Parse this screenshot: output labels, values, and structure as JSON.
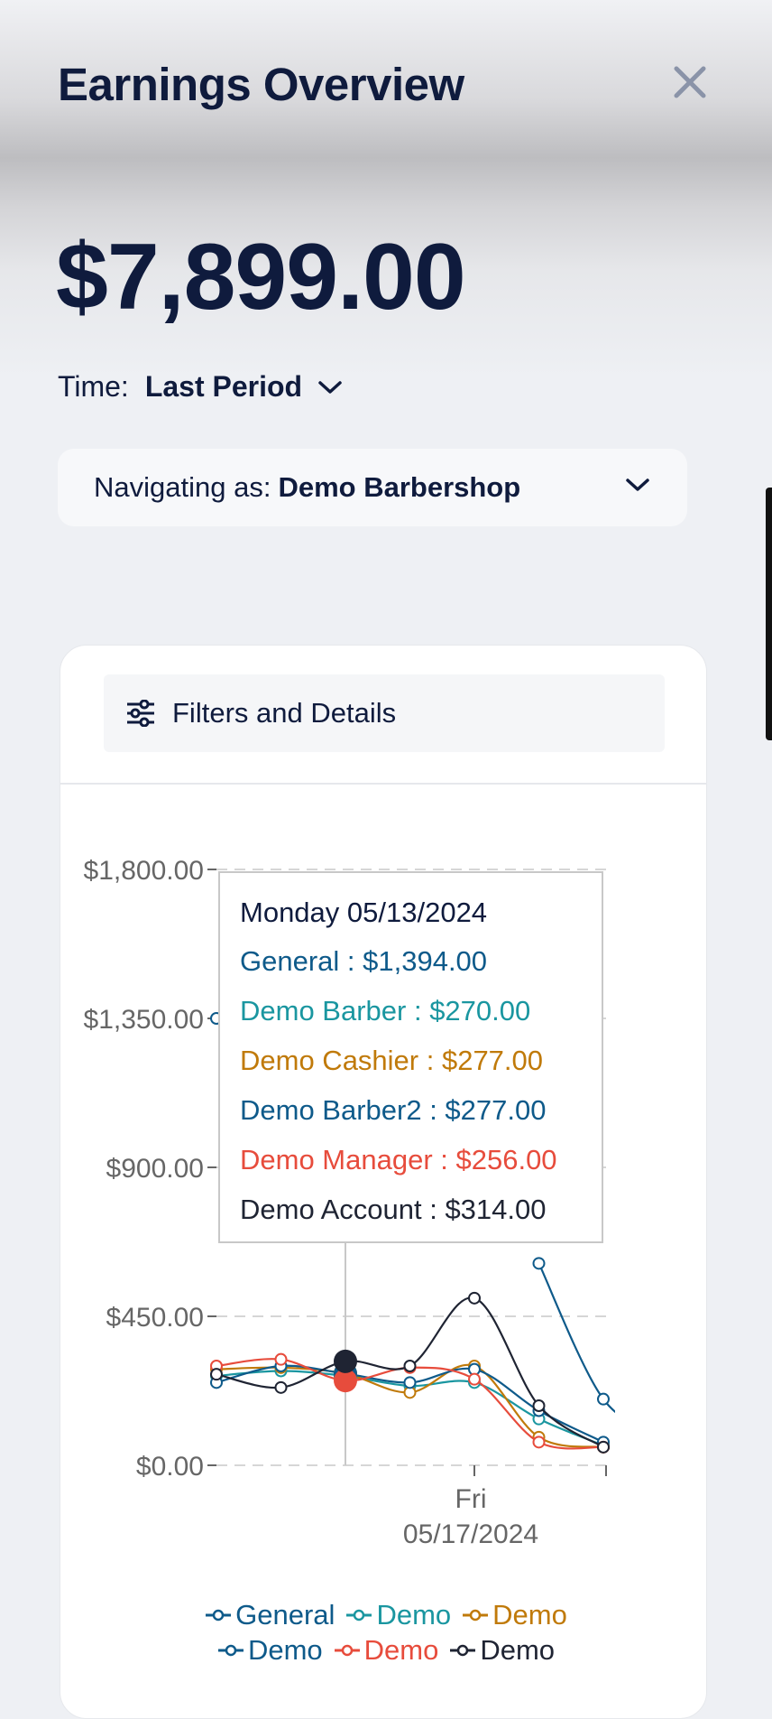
{
  "header": {
    "title": "Earnings Overview",
    "close_icon": "close-icon"
  },
  "summary": {
    "amount": "$7,899.00",
    "time_label": "Time:",
    "time_value": "Last Period"
  },
  "navigation": {
    "label": "Navigating as:",
    "value": "Demo Barbershop"
  },
  "filters": {
    "label": "Filters and Details",
    "icon": "sliders-icon"
  },
  "tooltip": {
    "date": "Monday 05/13/2024",
    "rows": [
      {
        "text": "General : $1,394.00",
        "color": "#0e5a8a"
      },
      {
        "text": "Demo Barber : $270.00",
        "color": "#1a96a0"
      },
      {
        "text": "Demo Cashier : $277.00",
        "color": "#c07a0a"
      },
      {
        "text": "Demo Barber2 : $277.00",
        "color": "#0e5a8a"
      },
      {
        "text": "Demo Manager : $256.00",
        "color": "#e74c3c"
      },
      {
        "text": "Demo Account : $314.00",
        "color": "#1f2433"
      }
    ]
  },
  "legend": [
    {
      "label": "General",
      "color": "#0e5a8a"
    },
    {
      "label": "Demo",
      "color": "#1a96a0"
    },
    {
      "label": "Demo",
      "color": "#c07a0a"
    },
    {
      "label": "Demo",
      "color": "#0e5a8a"
    },
    {
      "label": "Demo",
      "color": "#e74c3c"
    },
    {
      "label": "Demo",
      "color": "#1f2433"
    }
  ],
  "chart_data": {
    "type": "line",
    "y_ticks": [
      "$0.00",
      "$450.00",
      "$900.00",
      "$1,350.00",
      "$1,800.00"
    ],
    "ylim": [
      0,
      1800
    ],
    "x_tick_label": {
      "day": "Fri",
      "date": "05/17/2024"
    },
    "x_tick_index": 4,
    "active_index": 2,
    "grid": true,
    "series": [
      {
        "color": "#0e5a8a",
        "values": [
          1350,
          null,
          null,
          null,
          null,
          610,
          200,
          85
        ]
      },
      {
        "color": "#1a96a0",
        "values": [
          270,
          285,
          270,
          240,
          250,
          140,
          60
        ]
      },
      {
        "color": "#c07a0a",
        "values": [
          290,
          295,
          277,
          220,
          300,
          85,
          55
        ]
      },
      {
        "color": "#0e5a8a",
        "values": [
          250,
          300,
          277,
          250,
          290,
          165,
          70
        ]
      },
      {
        "color": "#e74c3c",
        "values": [
          300,
          320,
          256,
          295,
          260,
          70,
          55
        ]
      },
      {
        "color": "#1f2433",
        "values": [
          275,
          235,
          314,
          300,
          505,
          180,
          55
        ]
      }
    ]
  }
}
